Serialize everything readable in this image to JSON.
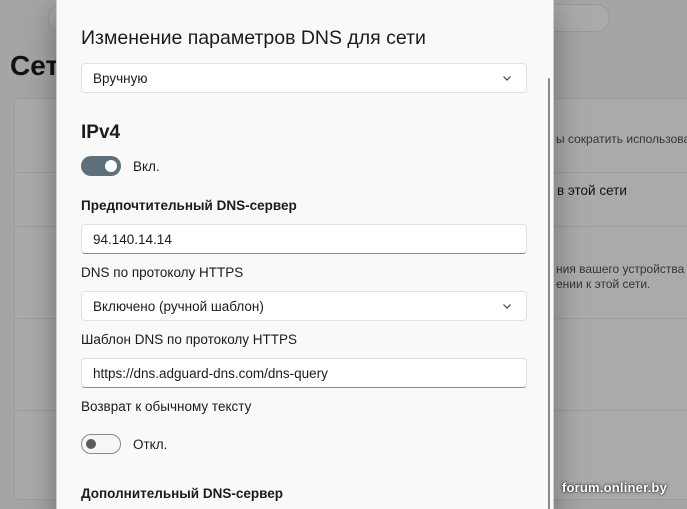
{
  "background": {
    "title": "Сет",
    "line1": "ы сократить использова",
    "line2": "в этой сети",
    "line3": "ния вашего устройства",
    "line4": "ении к этой сети."
  },
  "dialog": {
    "title": "Изменение параметров DNS для сети",
    "mode_value": "Вручную",
    "ipv4_heading": "IPv4",
    "ipv4_toggle": {
      "state": "on",
      "label": "Вкл."
    },
    "preferred_dns_label": "Предпочтительный DNS-сервер",
    "preferred_dns_value": "94.140.14.14",
    "https_label": "DNS по протоколу HTTPS",
    "https_value": "Включено (ручной шаблон)",
    "https_template_label": "Шаблон DNS по протоколу HTTPS",
    "https_template_value": "https://dns.adguard-dns.com/dns-query",
    "fallback_label": "Возврат к обычному тексту",
    "fallback_toggle": {
      "state": "off",
      "label": "Откл."
    },
    "alternate_dns_label": "Дополнительный DNS-сервер"
  },
  "watermark": "forum.onliner.by",
  "icons": {
    "dropdown": "chevron-down-icon"
  }
}
